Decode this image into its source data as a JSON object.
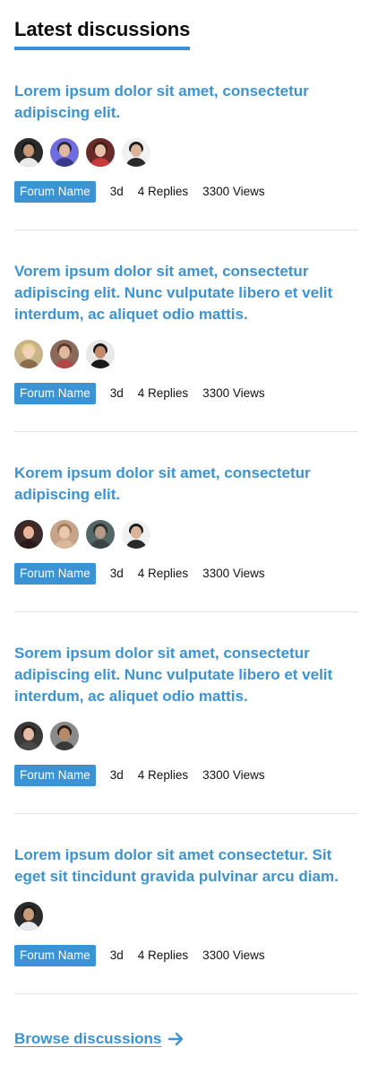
{
  "heading": "Latest discussions",
  "colors": {
    "accent": "#3b93d4",
    "divider": "#e3e3e3",
    "text": "#111111"
  },
  "discussions": [
    {
      "title": "Lorem ipsum dolor sit amet, consectetur adipiscing elit.",
      "forum": "Forum Name",
      "age": "3d",
      "replies": "4 Replies",
      "views": "3300 Views",
      "avatars": [
        {
          "bg": "#2b2b2b",
          "skin": "#c99a7a",
          "hair": "#1a1a1a",
          "cloth": "#e9e9e9"
        },
        {
          "bg": "#6f6ee0",
          "skin": "#e0b7a0",
          "hair": "#2a2a3a",
          "cloth": "#3a3a8a"
        },
        {
          "bg": "#6b2a2a",
          "skin": "#e7c0a8",
          "hair": "#3b1e14",
          "cloth": "#c53a3a"
        },
        {
          "bg": "#f1f1f1",
          "skin": "#d9b39a",
          "hair": "#1d1d1d",
          "cloth": "#2a2a2a"
        }
      ]
    },
    {
      "title": "Vorem ipsum dolor sit amet, consectetur adipiscing elit. Nunc vulputate libero et velit interdum, ac aliquet odio mattis.",
      "forum": "Forum Name",
      "age": "3d",
      "replies": "4 Replies",
      "views": "3300 Views",
      "avatars": [
        {
          "bg": "#c9b48a",
          "skin": "#efd2b8",
          "hair": "#e8cf8c",
          "cloth": "#8a6c4a"
        },
        {
          "bg": "#8a6b5a",
          "skin": "#e2b89c",
          "hair": "#5a3a2a",
          "cloth": "#b04a4a"
        },
        {
          "bg": "#e8e8e8",
          "skin": "#c48c6c",
          "hair": "#1a1a1a",
          "cloth": "#1a1a1a"
        }
      ]
    },
    {
      "title": "Korem ipsum dolor sit amet, consectetur adipiscing elit.",
      "forum": "Forum Name",
      "age": "3d",
      "replies": "4 Replies",
      "views": "3300 Views",
      "avatars": [
        {
          "bg": "#3a2a2a",
          "skin": "#e6b49a",
          "hair": "#4a2418",
          "cloth": "#2a1a1a"
        },
        {
          "bg": "#c7a38a",
          "skin": "#e9c8ae",
          "hair": "#a07a5a",
          "cloth": "#d8b89a"
        },
        {
          "bg": "#556666",
          "skin": "#b79a86",
          "hair": "#2a3030",
          "cloth": "#3a4444"
        },
        {
          "bg": "#f1f1f1",
          "skin": "#d9b39a",
          "hair": "#1d1d1d",
          "cloth": "#2a2a2a"
        }
      ]
    },
    {
      "title": "Sorem ipsum dolor sit amet, consectetur adipiscing elit. Nunc vulputate libero et velit interdum, ac aliquet odio mattis.",
      "forum": "Forum Name",
      "age": "3d",
      "replies": "4 Replies",
      "views": "3300 Views",
      "avatars": [
        {
          "bg": "#3a3a3a",
          "skin": "#e3bba4",
          "hair": "#2a1c16",
          "cloth": "#4a4a4a"
        },
        {
          "bg": "#8a8a8a",
          "skin": "#b88a6a",
          "hair": "#2a1a12",
          "cloth": "#3a3a3a"
        }
      ]
    },
    {
      "title": "Lorem ipsum dolor sit amet consectetur. Sit eget sit tincidunt gravida pulvinar arcu diam.",
      "forum": "Forum Name",
      "age": "3d",
      "replies": "4 Replies",
      "views": "3300 Views",
      "avatars": [
        {
          "bg": "#2b2b2b",
          "skin": "#c99a7a",
          "hair": "#1a1a1a",
          "cloth": "#e9e9e9"
        }
      ]
    }
  ],
  "browse": {
    "label": "Browse discussions",
    "icon": "arrow-right-icon"
  }
}
